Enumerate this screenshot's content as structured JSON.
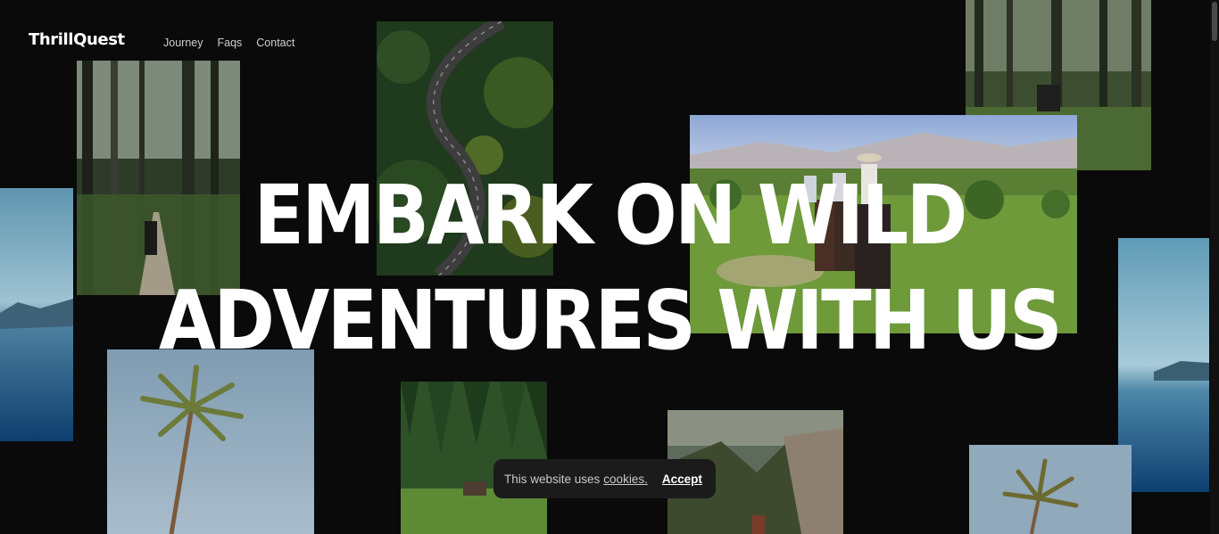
{
  "brand": {
    "name": "ThrillQuest"
  },
  "nav": {
    "items": [
      "Journey",
      "Faqs",
      "Contact"
    ]
  },
  "hero": {
    "line1": "EMBARK ON WILD",
    "line2": "ADVENTURES WITH US"
  },
  "cookie_banner": {
    "text": "This website uses",
    "link_label": "cookies.",
    "accept_label": "Accept"
  },
  "colors": {
    "background": "#0a0a0a",
    "text": "#ffffff",
    "nav_text": "#cfcfcf",
    "cookie_bg": "#1b1b1b"
  }
}
